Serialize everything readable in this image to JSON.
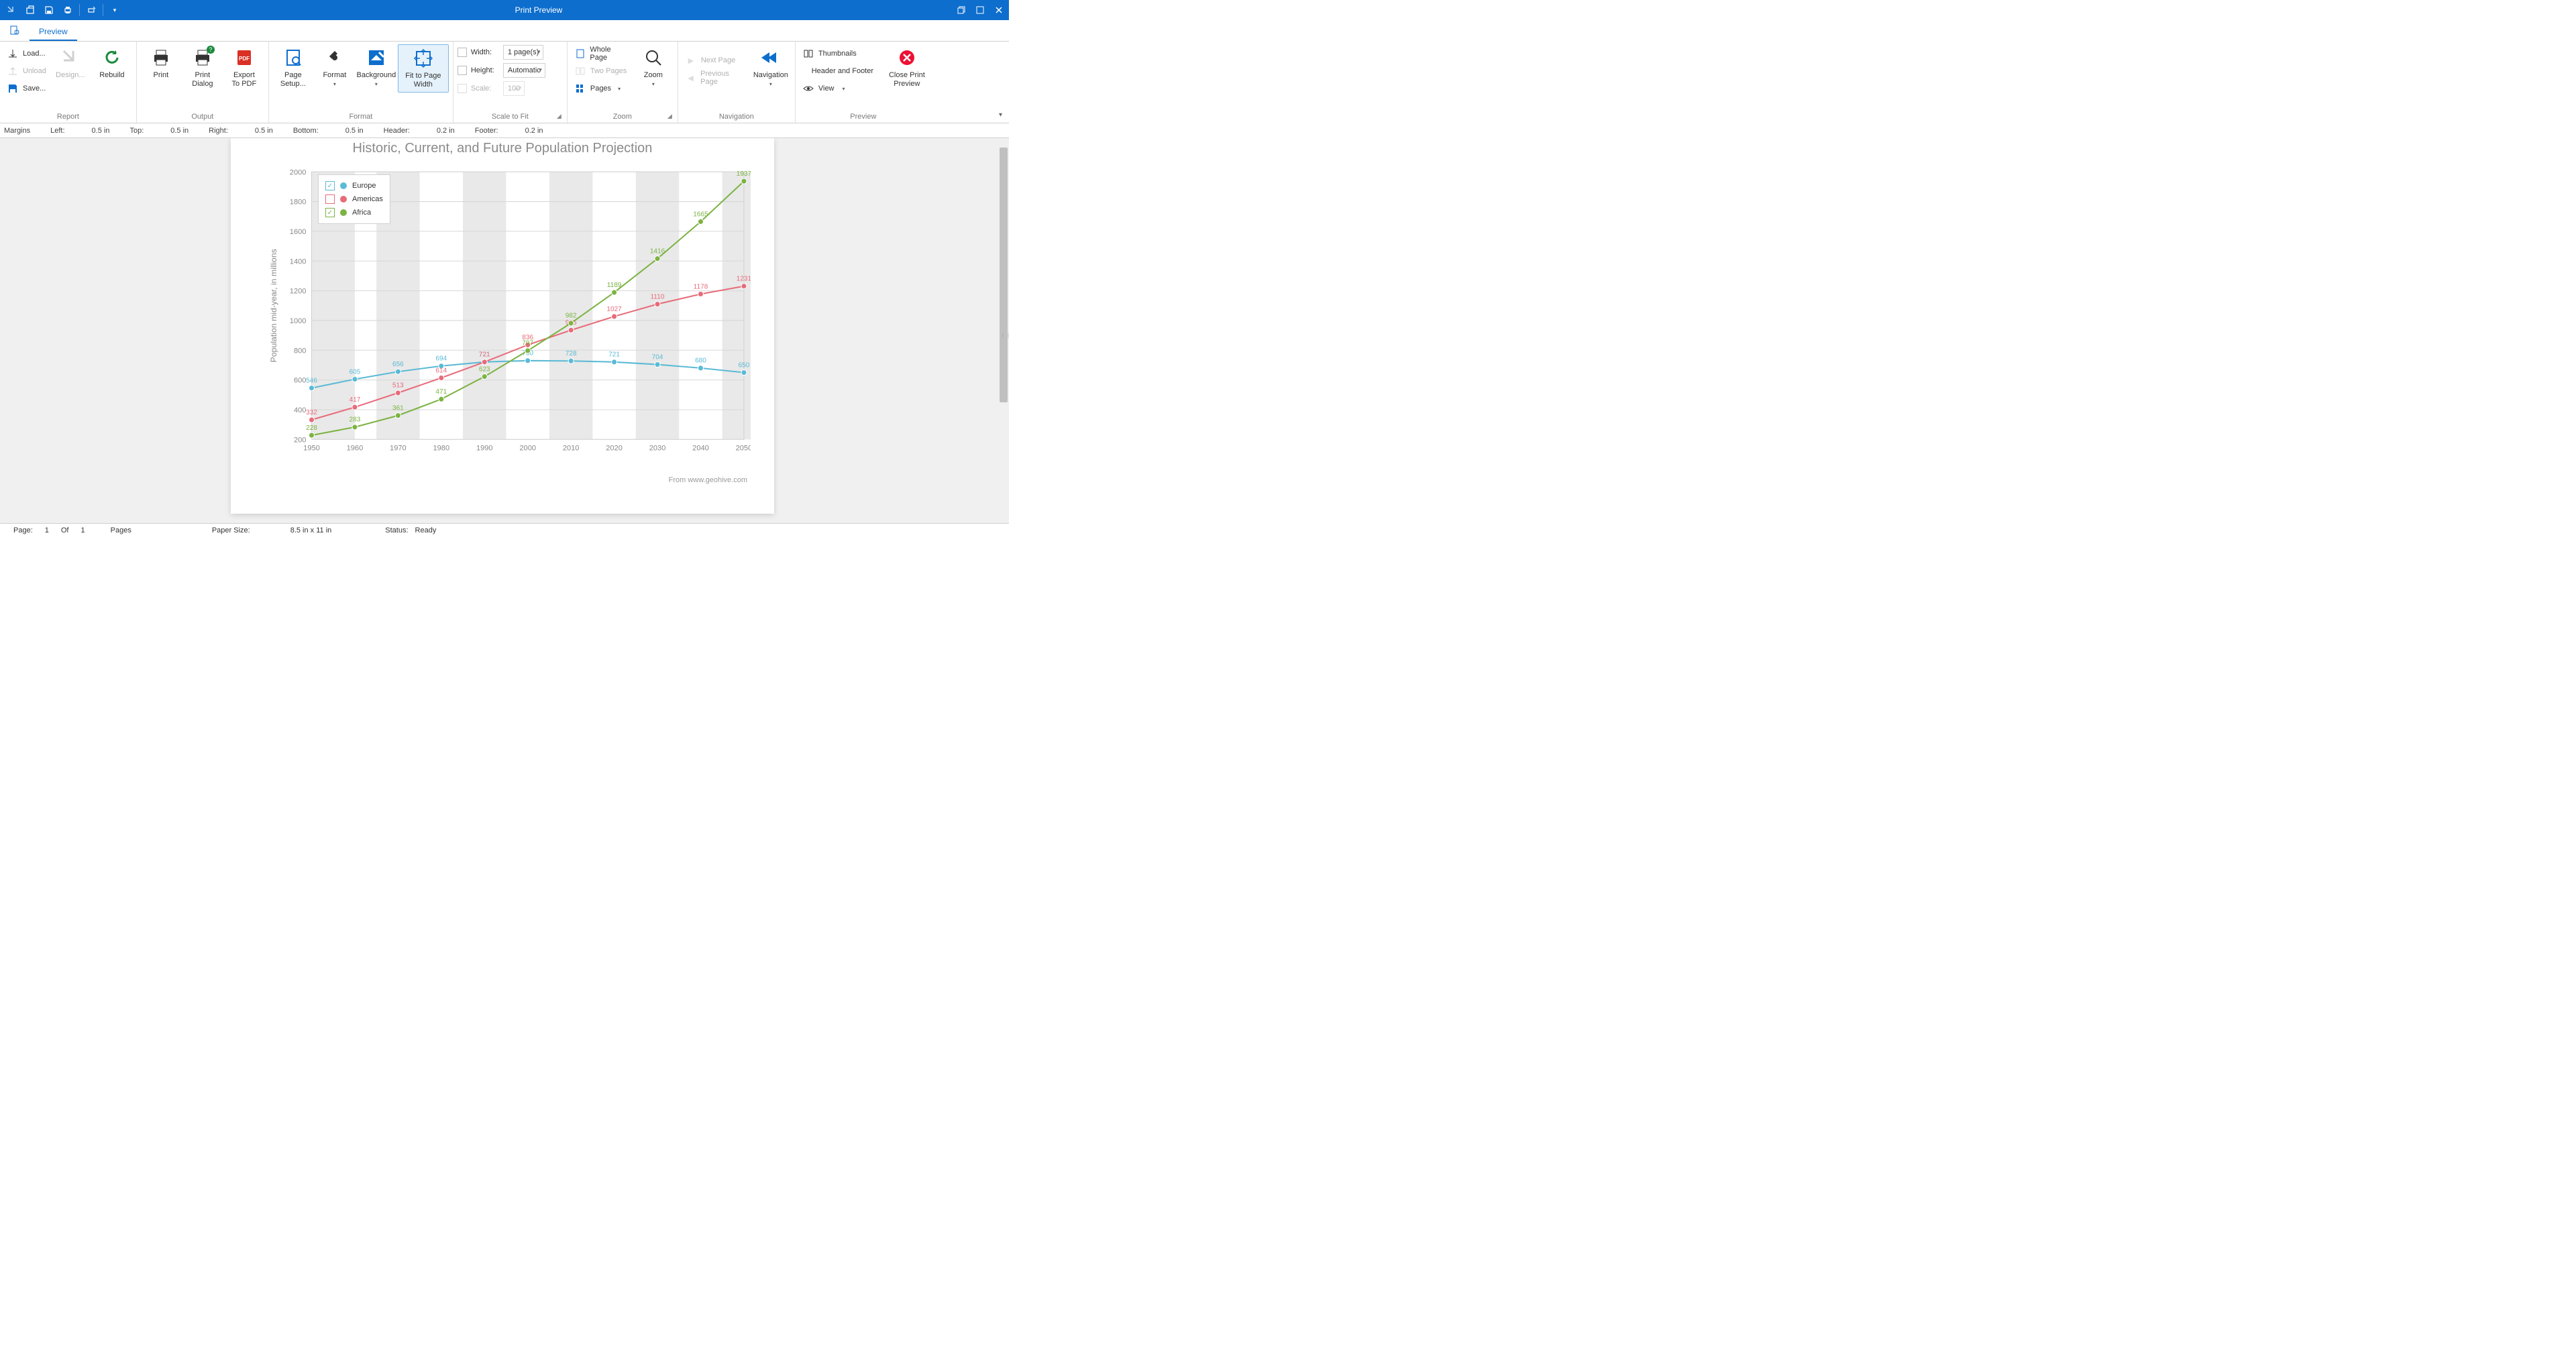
{
  "window": {
    "title": "Print Preview"
  },
  "qat": {
    "items": [
      "open",
      "save",
      "print",
      "quick-print",
      "more"
    ]
  },
  "tabs": {
    "preview": "Preview"
  },
  "ribbon": {
    "report": {
      "label": "Report",
      "load": "Load...",
      "unload": "Unload",
      "save": "Save...",
      "design": "Design...",
      "rebuild": "Rebuild"
    },
    "output": {
      "label": "Output",
      "print": "Print",
      "print_dialog": "Print Dialog",
      "export_pdf_l1": "Export",
      "export_pdf_l2": "To PDF"
    },
    "format": {
      "label": "Format",
      "page_setup_l1": "Page",
      "page_setup_l2": "Setup...",
      "format_btn": "Format",
      "background": "Background",
      "fit_l1": "Fit to Page",
      "fit_l2": "Width"
    },
    "scale": {
      "label": "Scale to Fit",
      "width_lbl": "Width:",
      "width_val": "1 page(s)",
      "height_lbl": "Height:",
      "height_val": "Automatic",
      "scale_lbl": "Scale:",
      "scale_val": "100"
    },
    "zoom": {
      "label": "Zoom",
      "whole": "Whole Page",
      "two": "Two Pages",
      "pages": "Pages",
      "zoom": "Zoom"
    },
    "nav": {
      "label": "Navigation",
      "next": "Next Page",
      "prev": "Previous Page",
      "navigation": "Navigation"
    },
    "preview": {
      "label": "Preview",
      "thumbs": "Thumbnails",
      "hf": "Header and Footer",
      "view": "View",
      "close_l1": "Close Print",
      "close_l2": "Preview"
    }
  },
  "margins": {
    "title": "Margins",
    "left_lbl": "Left:",
    "left_val": "0.5 in",
    "top_lbl": "Top:",
    "top_val": "0.5 in",
    "right_lbl": "Right:",
    "right_val": "0.5 in",
    "bottom_lbl": "Bottom:",
    "bottom_val": "0.5 in",
    "header_lbl": "Header:",
    "header_val": "0.2 in",
    "footer_lbl": "Footer:",
    "footer_val": "0.2 in"
  },
  "status": {
    "page_lbl": "Page:",
    "page_cur": "1",
    "of": "Of",
    "page_tot": "1",
    "pages": "Pages",
    "paper_lbl": "Paper Size:",
    "paper_val": "8.5 in x 11 in",
    "status_lbl": "Status:",
    "status_val": "Ready"
  },
  "chart_data": {
    "type": "line",
    "title": "Historic, Current, and Future Population Projection",
    "ylabel": "Population mid-year, in millions",
    "xlabel": "",
    "source": "From www.geohive.com",
    "categories": [
      1950,
      1960,
      1970,
      1980,
      1990,
      2000,
      2010,
      2020,
      2030,
      2040,
      2050
    ],
    "ylim": [
      200,
      2000
    ],
    "yticks": [
      200,
      400,
      600,
      800,
      1000,
      1200,
      1400,
      1600,
      1800,
      2000
    ],
    "series": [
      {
        "name": "Europe",
        "color": "#5bbad5",
        "checked": true,
        "values": [
          546,
          605,
          656,
          694,
          721,
          730,
          728,
          721,
          704,
          680,
          650
        ]
      },
      {
        "name": "Americas",
        "color": "#e86b7a",
        "checked": false,
        "values": [
          332,
          417,
          513,
          614,
          721,
          836,
          935,
          1027,
          1110,
          1178,
          1231
        ]
      },
      {
        "name": "Africa",
        "color": "#7cb342",
        "checked": true,
        "values": [
          228,
          283,
          361,
          471,
          623,
          797,
          982,
          1189,
          1416,
          1665,
          1937
        ]
      }
    ]
  }
}
